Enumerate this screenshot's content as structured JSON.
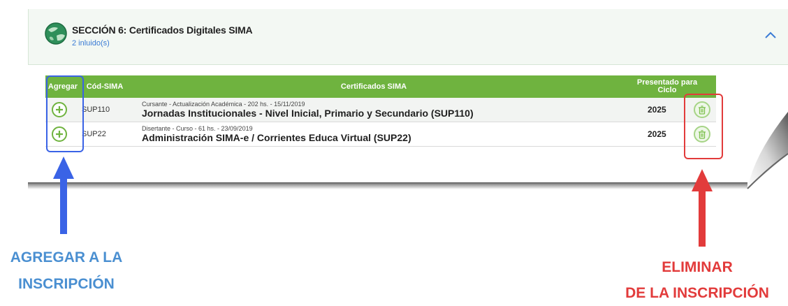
{
  "section": {
    "title": "SECCIÓN 6: Certificados Digitales SIMA",
    "subtitle": "2 inluido(s)"
  },
  "table": {
    "headers": {
      "add": "Agregar",
      "code": "Cód-SIMA",
      "cert": "Certificados SIMA",
      "presented_line1": "Presentado para",
      "presented_line2": "Ciclo"
    },
    "rows": [
      {
        "code": "SUP110",
        "detail": "Cursante - Actualización Académica - 202 hs. - 15/11/2019",
        "title": "Jornadas Institucionales - Nivel Inicial, Primario y Secundario (SUP110)",
        "year": "2025"
      },
      {
        "code": "SUP22",
        "detail": "Disertante - Curso - 61 hs. - 23/09/2019",
        "title": "Administración SIMA-e / Corrientes Educa Virtual (SUP22)",
        "year": "2025"
      }
    ]
  },
  "annotations": {
    "add_line1": "AGREGAR A LA",
    "add_line2": "INSCRIPCIÓN",
    "remove_line1": "ELIMINAR",
    "remove_line2": "DE LA INSCRIPCIÓN"
  },
  "colors": {
    "header_green": "#6fb33f",
    "link_blue": "#3a7bd5",
    "highlight_blue": "#3a63e6",
    "highlight_red": "#e23b3b",
    "annotation_blue": "#4a8fd1"
  }
}
